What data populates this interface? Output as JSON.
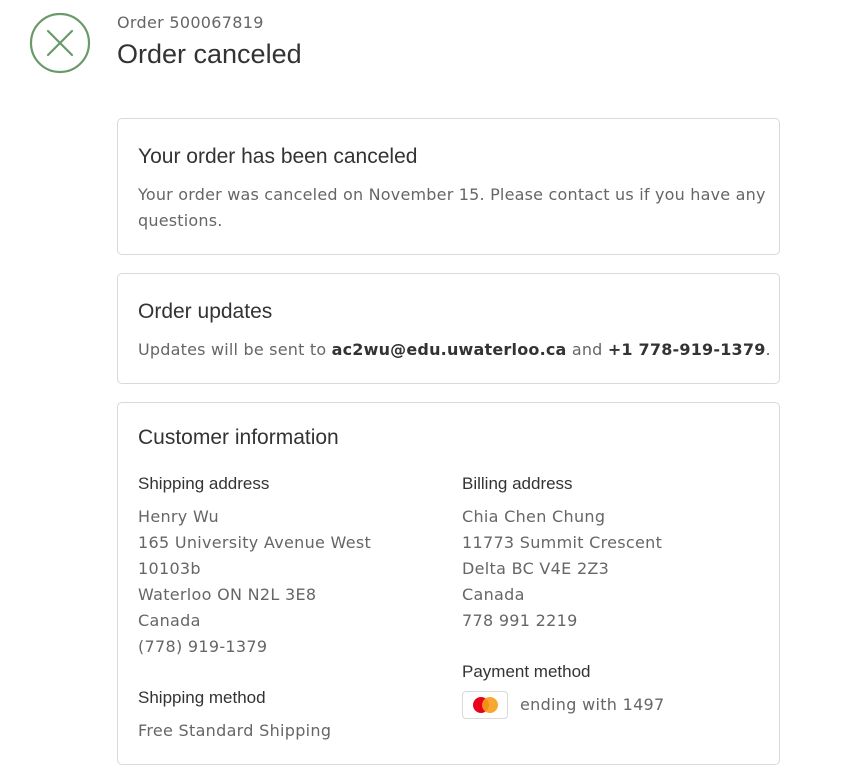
{
  "header": {
    "order_number": "Order 500067819",
    "title": "Order canceled",
    "status_color": "#6a9a6a"
  },
  "canceled_card": {
    "title": "Your order has been canceled",
    "message": "Your order was canceled on November 15. Please contact us if you have any questions."
  },
  "updates_card": {
    "title": "Order updates",
    "prefix": "Updates will be sent to ",
    "email": "ac2wu@edu.uwaterloo.ca",
    "connector": " and ",
    "phone": "+1 778-919-1379",
    "suffix": "."
  },
  "customer_card": {
    "title": "Customer information",
    "shipping_address": {
      "heading": "Shipping address",
      "lines": [
        "Henry Wu",
        "165 University Avenue West",
        "10103b",
        "Waterloo ON N2L 3E8",
        "Canada",
        "(778) 919-1379"
      ]
    },
    "billing_address": {
      "heading": "Billing address",
      "lines": [
        "Chia Chen Chung",
        "11773 Summit Crescent",
        "Delta BC V4E 2Z3",
        "Canada",
        "778 991 2219"
      ]
    },
    "shipping_method": {
      "heading": "Shipping method",
      "value": "Free Standard Shipping"
    },
    "payment_method": {
      "heading": "Payment method",
      "card_icon": "mastercard-icon",
      "value": "ending with 1497"
    }
  },
  "colors": {
    "mastercard_red": "#eb001b",
    "mastercard_orange": "#f79e1b"
  }
}
